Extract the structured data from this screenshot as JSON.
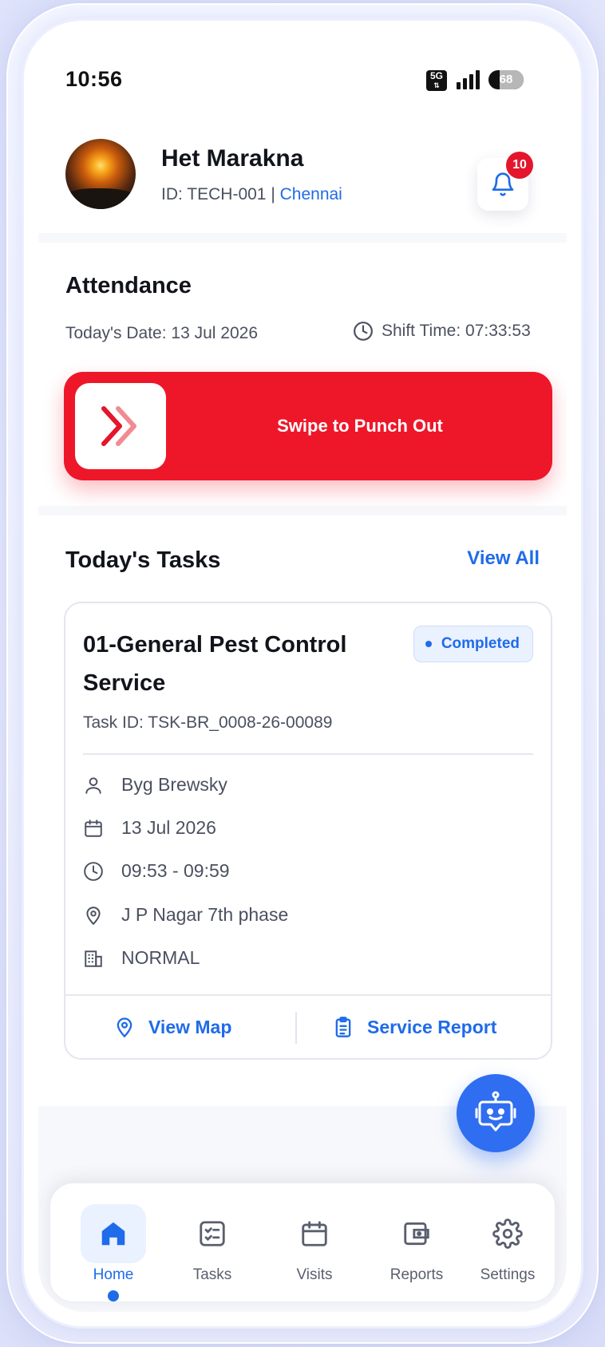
{
  "status_bar": {
    "time": "10:56",
    "network": "5G",
    "battery": "68"
  },
  "header": {
    "user_name": "Het Marakna",
    "id_text": "ID: TECH-001 | ",
    "city": "Chennai",
    "notification_count": "10"
  },
  "attendance": {
    "title": "Attendance",
    "date_text": "Today's Date: 13 Jul 2026",
    "shift_text": "Shift Time: 07:33:53",
    "swipe_label": "Swipe to Punch Out"
  },
  "tasks": {
    "title": "Today's Tasks",
    "view_all": "View All",
    "card": {
      "name": "01-General Pest Control Service",
      "status": "Completed",
      "task_id": "Task ID: TSK-BR_0008-26-00089",
      "customer": "Byg Brewsky",
      "date": "13 Jul 2026",
      "time": "09:53 - 09:59",
      "location": "J P Nagar 7th phase",
      "priority": "NORMAL",
      "view_map": "View Map",
      "service_report": "Service Report"
    }
  },
  "nav": {
    "items": [
      {
        "label": "Home",
        "icon": "home-icon",
        "active": true
      },
      {
        "label": "Tasks",
        "icon": "checklist-icon",
        "active": false
      },
      {
        "label": "Visits",
        "icon": "calendar-icon",
        "active": false
      },
      {
        "label": "Reports",
        "icon": "wallet-icon",
        "active": false
      },
      {
        "label": "Settings",
        "icon": "gear-icon",
        "active": false
      }
    ]
  },
  "colors": {
    "accent": "#1f6bea",
    "danger": "#ee1729",
    "text": "#12141c",
    "muted": "#4b5060"
  }
}
